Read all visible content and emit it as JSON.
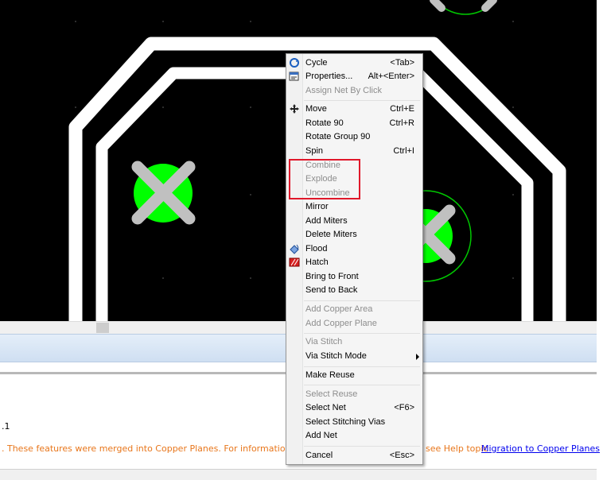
{
  "context_menu": {
    "items": [
      {
        "label": "Cycle",
        "shortcut": "<Tab>",
        "icon": "cycle-icon",
        "enabled": true
      },
      {
        "label": "Properties...",
        "shortcut": "Alt+<Enter>",
        "icon": "properties-icon",
        "enabled": true
      },
      {
        "label": "Assign Net By Click",
        "shortcut": "",
        "enabled": false
      },
      {
        "label": "Move",
        "shortcut": "Ctrl+E",
        "icon": "move-icon",
        "enabled": true
      },
      {
        "label": "Rotate 90",
        "shortcut": "Ctrl+R",
        "enabled": true
      },
      {
        "label": "Rotate Group 90",
        "shortcut": "",
        "enabled": true
      },
      {
        "label": "Spin",
        "shortcut": "Ctrl+I",
        "enabled": true
      },
      {
        "label": "Combine",
        "shortcut": "",
        "enabled": false
      },
      {
        "label": "Explode",
        "shortcut": "",
        "enabled": false
      },
      {
        "label": "Uncombine",
        "shortcut": "",
        "enabled": false
      },
      {
        "label": "Mirror",
        "shortcut": "",
        "enabled": true
      },
      {
        "label": "Add Miters",
        "shortcut": "",
        "enabled": true
      },
      {
        "label": "Delete Miters",
        "shortcut": "",
        "enabled": true
      },
      {
        "label": "Flood",
        "shortcut": "",
        "icon": "flood-icon",
        "enabled": true
      },
      {
        "label": "Hatch",
        "shortcut": "",
        "icon": "hatch-icon",
        "enabled": true
      },
      {
        "label": "Bring to Front",
        "shortcut": "",
        "enabled": true
      },
      {
        "label": "Send to Back",
        "shortcut": "",
        "enabled": true
      },
      {
        "label": "Add Copper Area",
        "shortcut": "",
        "enabled": false
      },
      {
        "label": "Add Copper Plane",
        "shortcut": "",
        "enabled": false
      },
      {
        "label": "Via Stitch",
        "shortcut": "",
        "enabled": false
      },
      {
        "label": "Via Stitch Mode",
        "shortcut": "",
        "enabled": true,
        "submenu": true
      },
      {
        "label": "Make Reuse",
        "shortcut": "",
        "enabled": true
      },
      {
        "label": "Select Reuse",
        "shortcut": "",
        "enabled": false
      },
      {
        "label": "Select Net",
        "shortcut": "<F6>",
        "enabled": true
      },
      {
        "label": "Select Stitching Vias",
        "shortcut": "",
        "enabled": true
      },
      {
        "label": "Add Net",
        "shortcut": "",
        "enabled": true
      },
      {
        "label": "Cancel",
        "shortcut": "<Esc>",
        "enabled": true
      }
    ]
  },
  "output": {
    "line1": ".1",
    "line2": ". These features were merged into Copper Planes. For information on potentia",
    "line2_tail": "see Help topic",
    "link_text": "Migration to Copper Planes"
  },
  "colors": {
    "board_bg": "#000000",
    "trace": "#ffffff",
    "pad": "#00ff00",
    "cross": "#c0c0c0",
    "highlight_box": "#e0182a"
  }
}
